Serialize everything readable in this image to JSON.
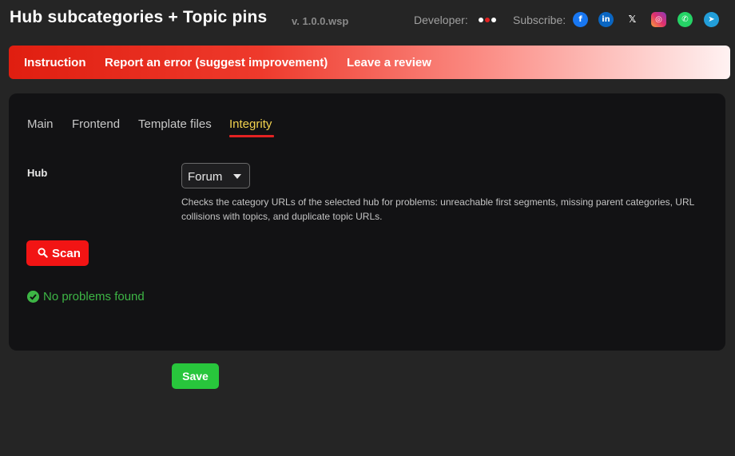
{
  "header": {
    "title": "Hub subcategories + Topic pins",
    "version": "v. 1.0.0.wsp",
    "developer_label": "Developer:",
    "subscribe_label": "Subscribe:",
    "dev_dots_colors": [
      "#ffffff",
      "#e32222",
      "#ffffff"
    ],
    "social": [
      {
        "name": "facebook-icon",
        "glyph": "f",
        "color": "#1877f2"
      },
      {
        "name": "linkedin-icon",
        "glyph": "in",
        "color": "#0a66c2"
      },
      {
        "name": "x-icon",
        "glyph": "𝕏",
        "color": "#252525"
      },
      {
        "name": "instagram-icon",
        "glyph": "◎",
        "color": "#e1306c"
      },
      {
        "name": "whatsapp-icon",
        "glyph": "✆",
        "color": "#25d366"
      },
      {
        "name": "telegram-icon",
        "glyph": "➤",
        "color": "#229ed9"
      }
    ]
  },
  "banner": {
    "instruction": "Instruction",
    "report": "Report an error (suggest improvement)",
    "review": "Leave a review"
  },
  "tabs": [
    {
      "label": "Main"
    },
    {
      "label": "Frontend"
    },
    {
      "label": "Template files"
    },
    {
      "label": "Integrity",
      "active": true
    }
  ],
  "integrity": {
    "hub_label": "Hub",
    "hub_selected": "Forum",
    "description": "Checks the category URLs of the selected hub for problems: unreachable first segments, missing parent categories, URL collisions with topics, and duplicate topic URLs.",
    "scan_label": "Scan",
    "result": "No problems found"
  },
  "save_label": "Save",
  "colors": {
    "accent_red": "#f21414",
    "active_tab": "#f2d24e",
    "success": "#3db545",
    "save": "#28c63c"
  }
}
